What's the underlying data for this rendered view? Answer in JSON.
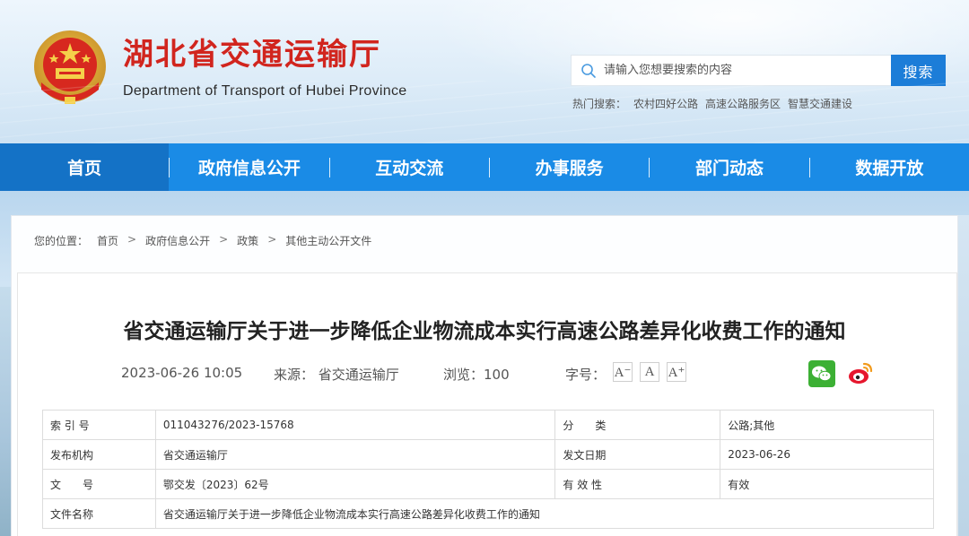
{
  "header": {
    "title": "湖北省交通运输厅",
    "subtitle": "Department of Transport of Hubei Province",
    "emblem_icon": "national-emblem-icon"
  },
  "search": {
    "placeholder": "请输入您想要搜索的内容",
    "button_label": "搜索",
    "hot_label": "热门搜索：",
    "hot_items": [
      "农村四好公路",
      "高速公路服务区",
      "智慧交通建设"
    ]
  },
  "nav": {
    "items": [
      {
        "label": "首页"
      },
      {
        "label": "政府信息公开"
      },
      {
        "label": "互动交流"
      },
      {
        "label": "办事服务"
      },
      {
        "label": "部门动态"
      },
      {
        "label": "数据开放"
      }
    ]
  },
  "breadcrumb": {
    "prefix": "您的位置：",
    "items": [
      "首页",
      "政府信息公开",
      "政策",
      "其他主动公开文件"
    ],
    "separator": ">"
  },
  "article": {
    "title": "省交通运输厅关于进一步降低企业物流成本实行高速公路差异化收费工作的通知",
    "date": "2023-06-26 10:05",
    "source_label": "来源：",
    "source": "省交通运输厅",
    "views_label": "浏览：",
    "views": "100",
    "fontsize_label": "字号：",
    "fontsize_buttons": [
      "A⁻",
      "A",
      "A⁺"
    ],
    "share_icons": [
      "wechat-icon",
      "weibo-icon"
    ]
  },
  "info_table": {
    "rows": [
      {
        "k1": "索 引 号",
        "v1": "011043276/2023-15768",
        "k2": "分　　类",
        "v2": "公路;其他"
      },
      {
        "k1": "发布机构",
        "v1": "省交通运输厅",
        "k2": "发文日期",
        "v2": "2023-06-26"
      },
      {
        "k1": "文　　号",
        "v1": "鄂交发〔2023〕62号",
        "k2": "有 效 性",
        "v2": "有效"
      },
      {
        "k1": "文件名称",
        "v1": "省交通运输厅关于进一步降低企业物流成本实行高速公路差异化收费工作的通知"
      }
    ]
  },
  "colors": {
    "brand_red": "#d1251e",
    "nav_blue": "#1a8be6",
    "nav_active": "#1472c6",
    "search_blue": "#1c7dd8"
  }
}
